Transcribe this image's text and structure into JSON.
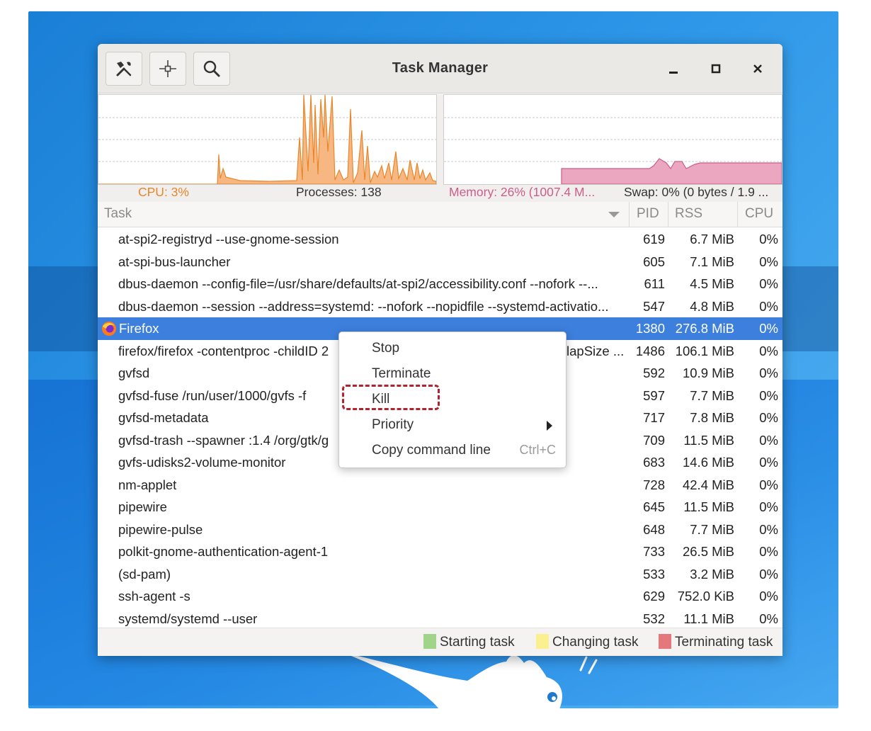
{
  "window": {
    "title": "Task Manager"
  },
  "toolbar": {
    "settings_icon": "tools-icon",
    "focus_icon": "crosshair-icon",
    "search_icon": "search-icon"
  },
  "window_controls": {
    "minimize": "minimize-icon",
    "maximize": "maximize-icon",
    "close": "close-icon"
  },
  "graphs": {
    "cpu_label": "CPU: 3%",
    "processes_label": "Processes: 138",
    "memory_label": "Memory: 26% (1007.4 M...",
    "swap_label": "Swap: 0% (0 bytes / 1.9 ...",
    "colors": {
      "cpu": "#e8862a",
      "memory": "#cc5d8a"
    }
  },
  "columns": {
    "task": "Task",
    "pid": "PID",
    "rss": "RSS",
    "cpu": "CPU"
  },
  "tasks": [
    {
      "name": "at-spi2-registryd --use-gnome-session",
      "pid": "619",
      "rss": "6.7 MiB",
      "cpu": "0%"
    },
    {
      "name": "at-spi-bus-launcher",
      "pid": "605",
      "rss": "7.1 MiB",
      "cpu": "0%"
    },
    {
      "name": "dbus-daemon --config-file=/usr/share/defaults/at-spi2/accessibility.conf --nofork --...",
      "pid": "611",
      "rss": "4.5 MiB",
      "cpu": "0%"
    },
    {
      "name": "dbus-daemon --session --address=systemd: --nofork --nopidfile --systemd-activatio...",
      "pid": "547",
      "rss": "4.8 MiB",
      "cpu": "0%"
    },
    {
      "name": "Firefox",
      "pid": "1380",
      "rss": "276.8 MiB",
      "cpu": "0%"
    },
    {
      "name": "firefox/firefox -contentproc -childID 2",
      "tail": "lapSize ...",
      "pid": "1486",
      "rss": "106.1 MiB",
      "cpu": "0%"
    },
    {
      "name": "gvfsd",
      "pid": "592",
      "rss": "10.9 MiB",
      "cpu": "0%"
    },
    {
      "name": "gvfsd-fuse /run/user/1000/gvfs -f",
      "pid": "597",
      "rss": "7.7 MiB",
      "cpu": "0%"
    },
    {
      "name": "gvfsd-metadata",
      "pid": "717",
      "rss": "7.8 MiB",
      "cpu": "0%"
    },
    {
      "name": "gvfsd-trash --spawner :1.4 /org/gtk/g",
      "pid": "709",
      "rss": "11.5 MiB",
      "cpu": "0%"
    },
    {
      "name": "gvfs-udisks2-volume-monitor",
      "pid": "683",
      "rss": "14.6 MiB",
      "cpu": "0%"
    },
    {
      "name": "nm-applet",
      "pid": "728",
      "rss": "42.4 MiB",
      "cpu": "0%"
    },
    {
      "name": "pipewire",
      "pid": "645",
      "rss": "11.5 MiB",
      "cpu": "0%"
    },
    {
      "name": "pipewire-pulse",
      "pid": "648",
      "rss": "7.7 MiB",
      "cpu": "0%"
    },
    {
      "name": "polkit-gnome-authentication-agent-1",
      "pid": "733",
      "rss": "26.5 MiB",
      "cpu": "0%"
    },
    {
      "name": "(sd-pam)",
      "pid": "533",
      "rss": "3.2 MiB",
      "cpu": "0%"
    },
    {
      "name": "ssh-agent -s",
      "pid": "629",
      "rss": "752.0 KiB",
      "cpu": "0%"
    },
    {
      "name": "systemd/systemd --user",
      "pid": "532",
      "rss": "11.1 MiB",
      "cpu": "0%"
    }
  ],
  "selected_row_color": "#3d7fdc",
  "context_menu": {
    "stop": "Stop",
    "terminate": "Terminate",
    "kill": "Kill",
    "priority": "Priority",
    "copy": "Copy command line",
    "copy_shortcut": "Ctrl+C",
    "highlight_color": "#b3222e"
  },
  "legend": {
    "starting": "Starting task",
    "changing": "Changing task",
    "terminating": "Terminating task",
    "colors": {
      "starting": "#9fd48a",
      "changing": "#fbef8f",
      "terminating": "#e5787c"
    }
  }
}
